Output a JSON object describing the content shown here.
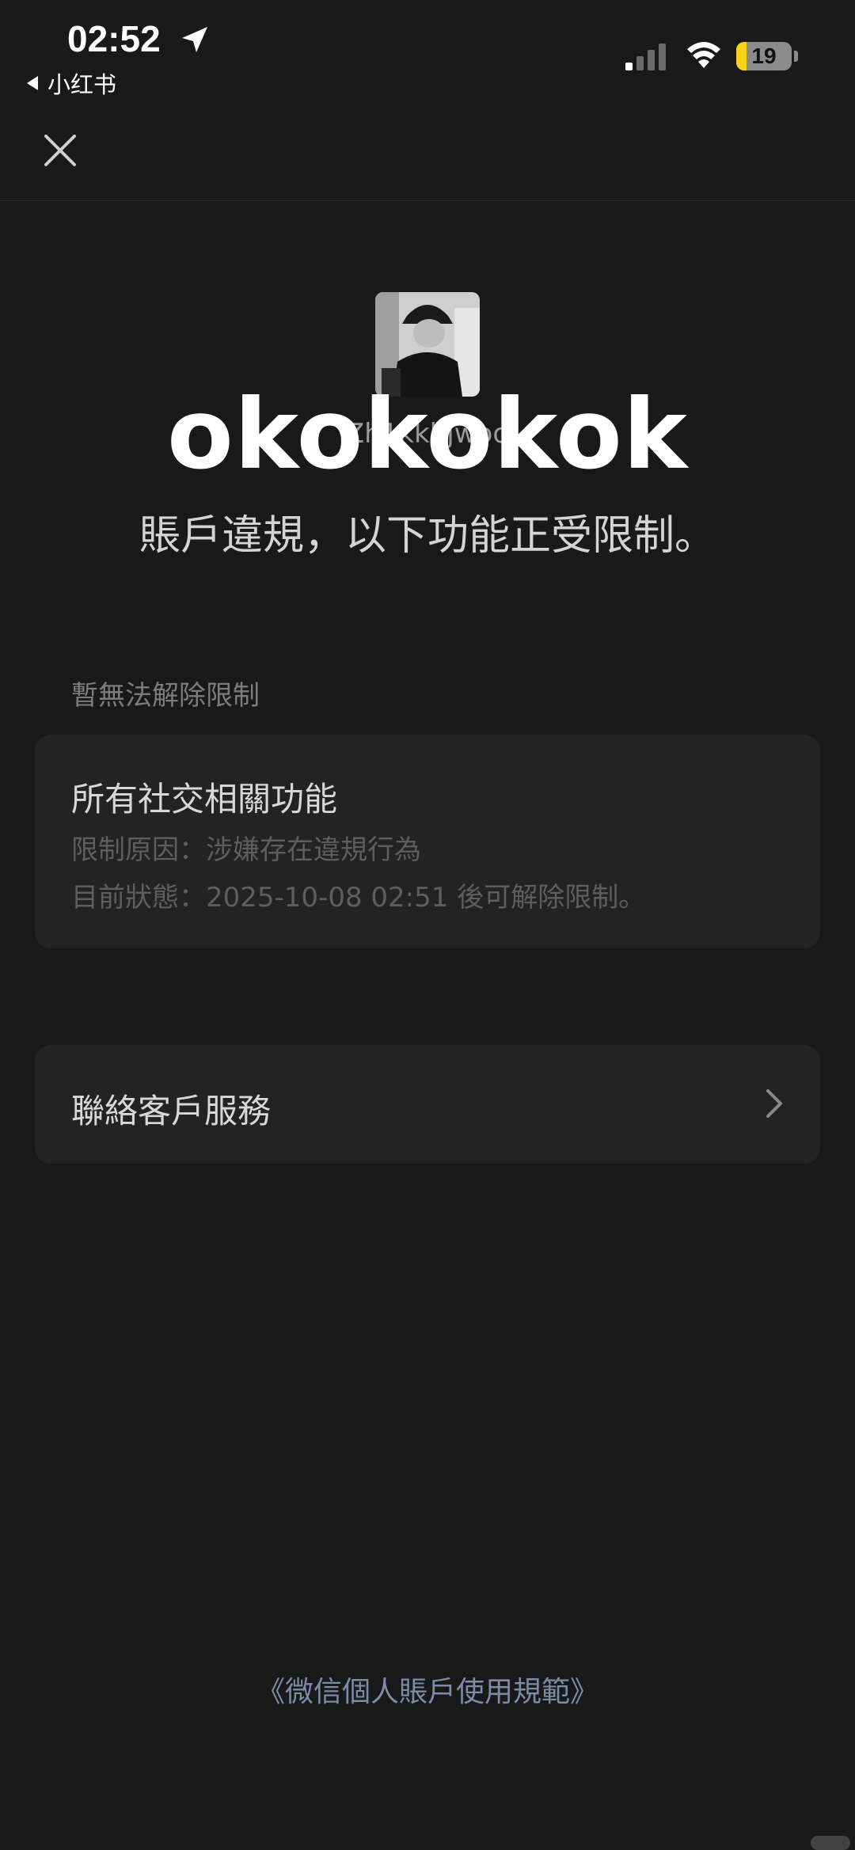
{
  "status_bar": {
    "time": "02:52",
    "back_app": "小红书",
    "battery_level": 19,
    "battery_text": "19",
    "battery_color": "#f7d41a"
  },
  "nav": {
    "close_icon": "close-icon"
  },
  "profile": {
    "avatar_icon": "avatar",
    "username": "Zh1kkhjwoo",
    "overlay_text": "okokokok"
  },
  "headline": "賬戶違規，以下功能正受限制。",
  "section_label": "暫無法解除限制",
  "restriction_card": {
    "title": "所有社交相關功能",
    "reason": "限制原因：涉嫌存在違規行為",
    "status": "目前狀態：2025-10-08 02:51 後可解除限制。"
  },
  "contact": {
    "label": "聯絡客戶服務",
    "chevron_icon": "chevron-right-icon"
  },
  "footer_link": "《微信個人賬戶使用規範》",
  "colors": {
    "background": "#191919",
    "card": "#232323",
    "link": "#7d8aa8"
  }
}
